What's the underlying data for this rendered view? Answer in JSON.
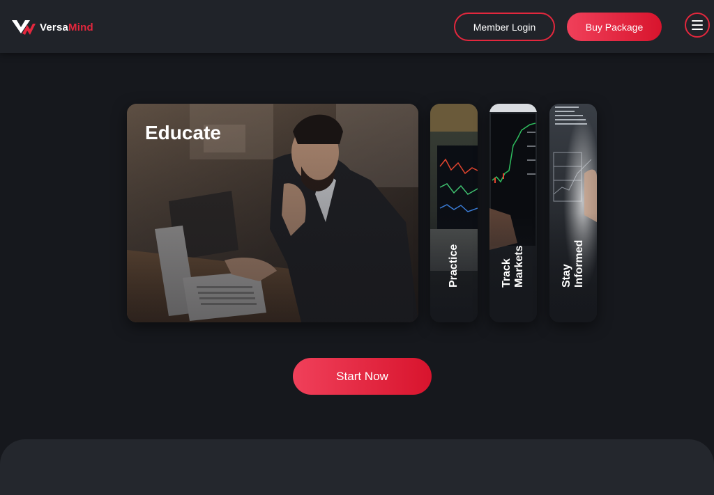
{
  "brand": {
    "part1": "Versa",
    "part2": "Mind",
    "logo_icon": "vm-logo-icon"
  },
  "header": {
    "login_label": "Member Login",
    "buy_label": "Buy Package",
    "menu_icon": "hamburger-menu-icon"
  },
  "cards": [
    {
      "label": "Educate"
    },
    {
      "label": "Practice"
    },
    {
      "label": "Track Markets"
    },
    {
      "label": "Stay Informed"
    }
  ],
  "cta": {
    "start_label": "Start Now"
  },
  "colors": {
    "accent": "#e3273d",
    "background": "#16181d",
    "header": "#202329"
  }
}
